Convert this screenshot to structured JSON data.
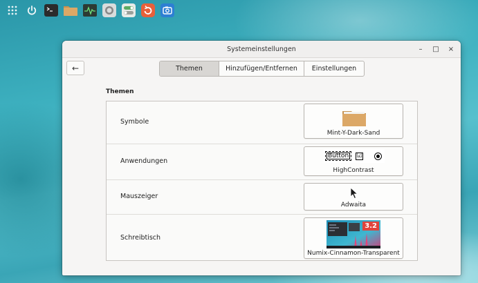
{
  "window": {
    "title": "Systemeinstellungen",
    "controls": {
      "minimize": "–",
      "maximize": "□",
      "close": "×"
    }
  },
  "nav": {
    "back": "←",
    "tabs": [
      {
        "label": "Themen",
        "active": true
      },
      {
        "label": "Hinzufügen/Entfernen",
        "active": false
      },
      {
        "label": "Einstellungen",
        "active": false
      }
    ]
  },
  "section": {
    "title": "Themen"
  },
  "themes": [
    {
      "label": "Symbole",
      "value": "Mint-Y-Dark-Sand"
    },
    {
      "label": "Anwendungen",
      "value": "HighContrast",
      "preview_button": "Button",
      "preview_check": "☑"
    },
    {
      "label": "Mauszeiger",
      "value": "Adwaita"
    },
    {
      "label": "Schreibtisch",
      "value": "Numix-Cinnamon-Transparent",
      "preview_badge": "3.2"
    }
  ],
  "panel": {
    "icons": [
      "apps-grid-icon",
      "power-icon",
      "terminal-icon",
      "folder-icon",
      "system-monitor-icon",
      "messaging-icon",
      "settings-toggle-icon",
      "software-updater-icon",
      "screenshot-icon"
    ]
  },
  "colors": {
    "accent_folder": "#d7a45f",
    "active_tab": "#d8d6d3",
    "badge": "#e0433c"
  }
}
